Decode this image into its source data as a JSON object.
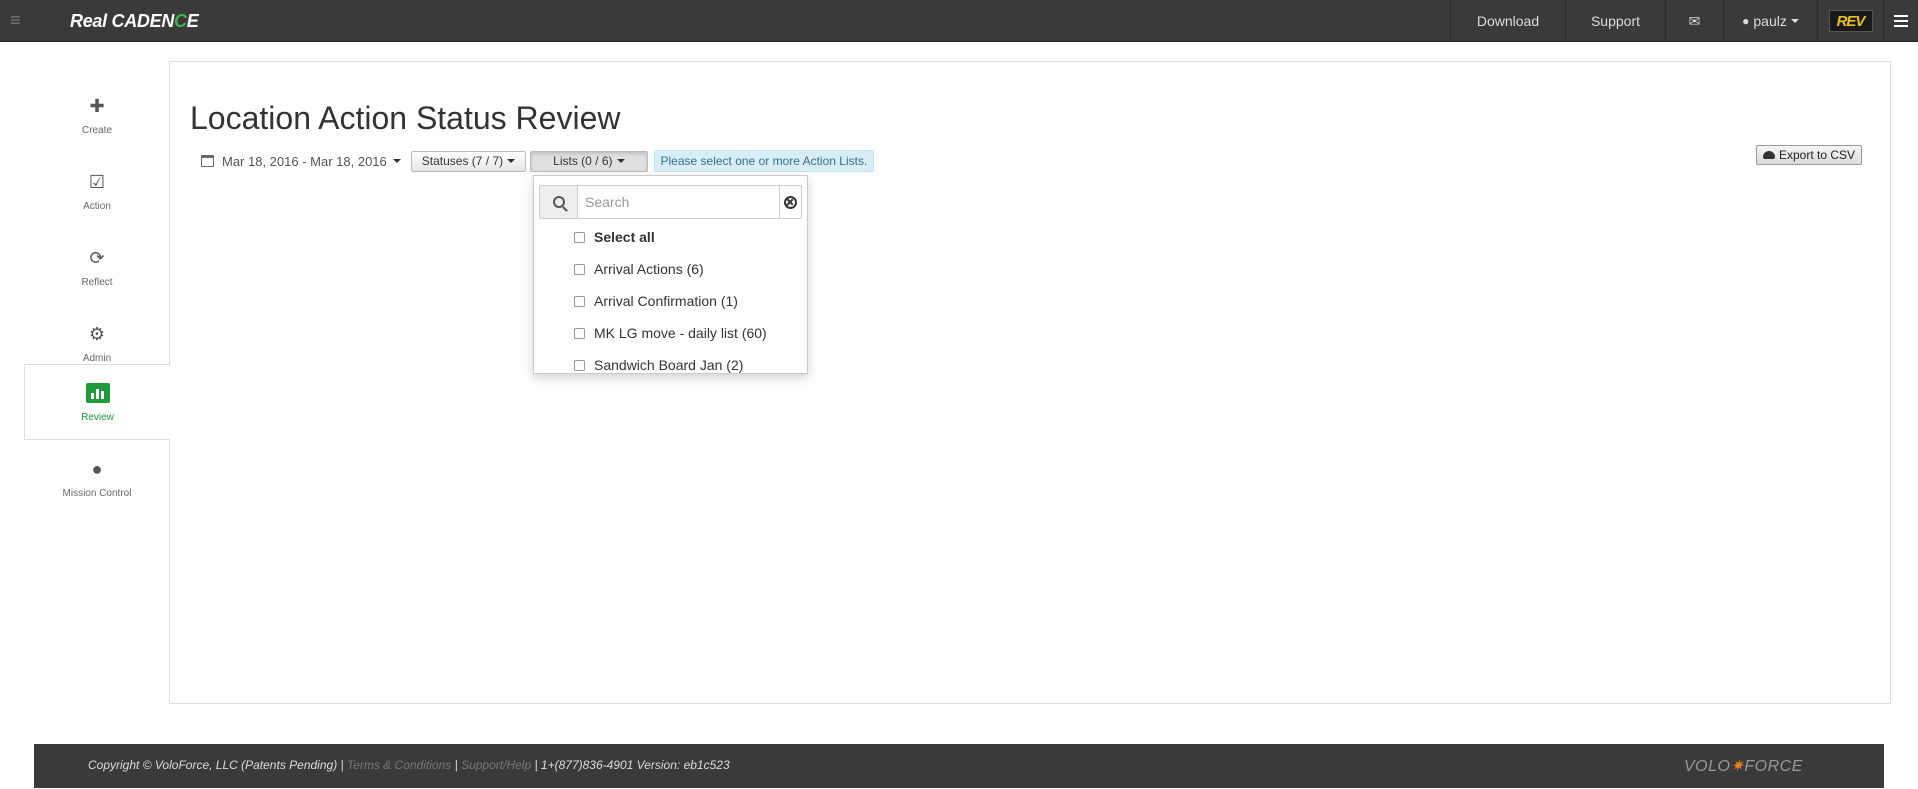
{
  "navbar": {
    "brand_prefix": "Real CADEN",
    "brand_accent": "C",
    "brand_suffix": "E",
    "download_label": "Download",
    "support_label": "Support",
    "mail_icon": "✉",
    "user_label": "paulz",
    "logo_text": "REV"
  },
  "sidebar": {
    "items": [
      {
        "label": "Create",
        "icon": "plus-icon"
      },
      {
        "label": "Action",
        "icon": "check-square-icon"
      },
      {
        "label": "Reflect",
        "icon": "refresh-icon"
      },
      {
        "label": "Admin",
        "icon": "gears-icon"
      },
      {
        "label": "Review",
        "icon": "bar-chart-icon",
        "active": true
      },
      {
        "label": "Mission Control",
        "icon": "globe-icon"
      }
    ]
  },
  "main": {
    "title": "Location Action Status Review",
    "date_range": "Mar 18, 2016 - Mar 18, 2016",
    "statuses_label": "Statuses (7 / 7)",
    "lists_label": "Lists (0 / 6)",
    "info_message": "Please select one or more Action Lists.",
    "export_label": "Export to CSV"
  },
  "dropdown": {
    "search_placeholder": "Search",
    "select_all": "Select all",
    "options": [
      "Arrival Actions (6)",
      "Arrival Confirmation (1)",
      "MK LG move - daily list (60)",
      "Sandwich Board Jan (2)"
    ]
  },
  "footer": {
    "copyright": "Copyright © VoloForce, LLC (Patents Pending) |",
    "terms": "Terms & Conditions",
    "sep": "|",
    "support": "Support/Help",
    "phone_version": "| 1+(877)836-4901 Version: eb1c523",
    "logo_left": "VOLO",
    "logo_right": "FORCE"
  },
  "colors": {
    "navbar_bg": "#3a3a3a",
    "accent_green": "#1e9c3a",
    "info_bg": "#d9edf7",
    "info_text": "#31708f"
  }
}
